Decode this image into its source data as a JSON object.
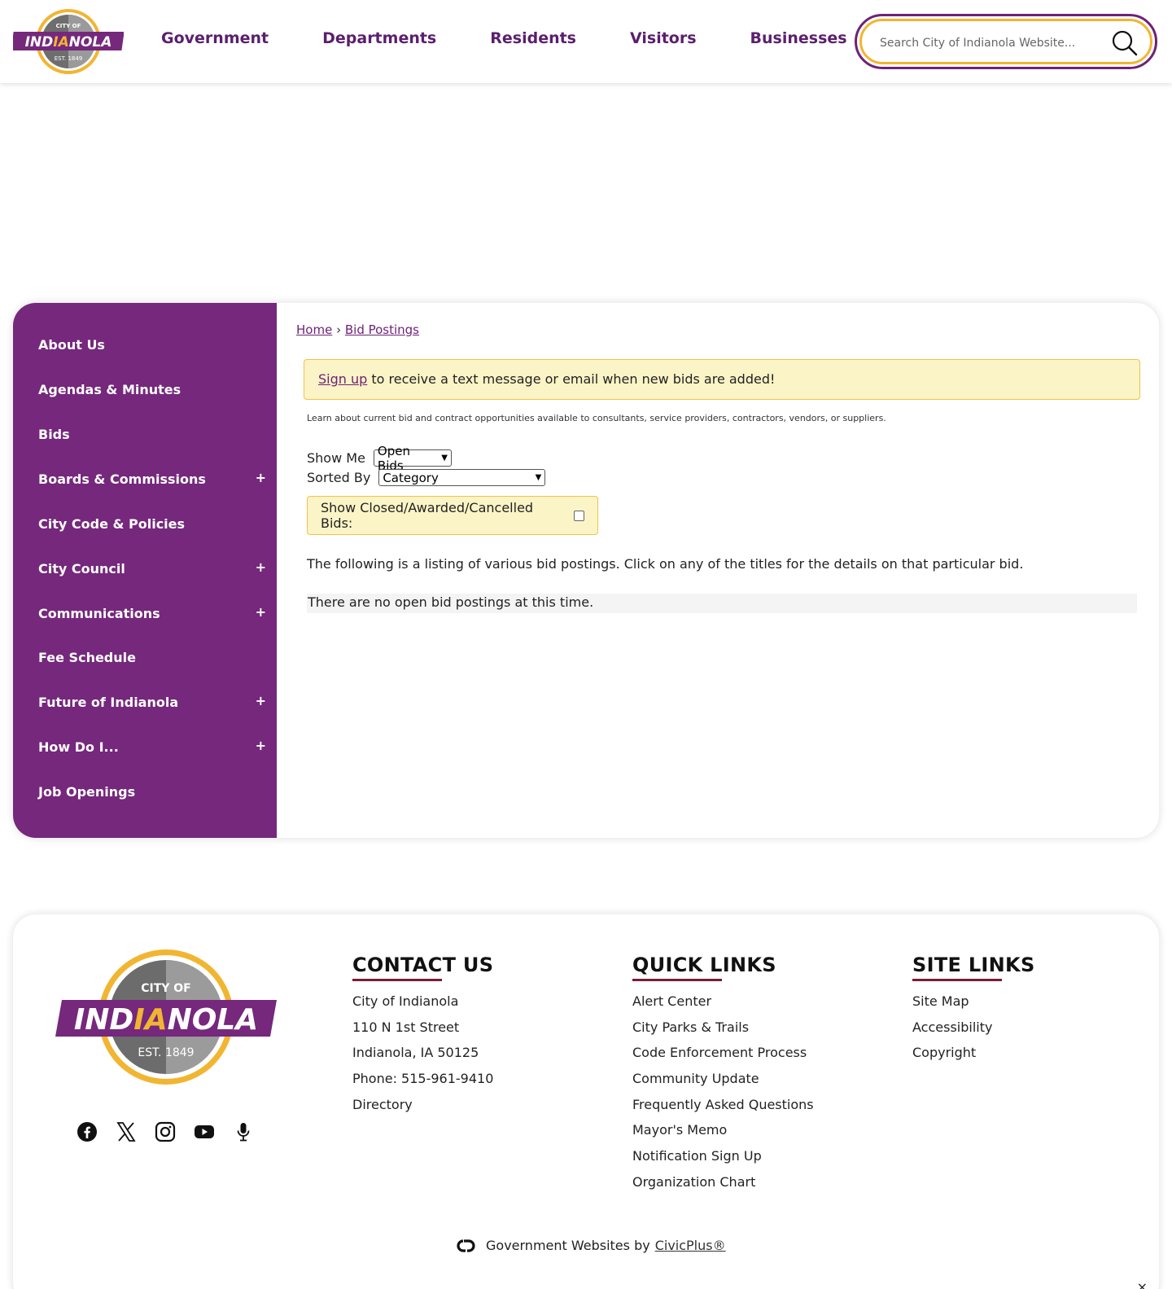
{
  "header": {
    "logo": {
      "top_text": "CITY OF",
      "name_part1": "IND",
      "name_part2": "IA",
      "name_part3": "NOLA",
      "est": "EST. 1849"
    },
    "nav": [
      "Government",
      "Departments",
      "Residents",
      "Visitors",
      "Businesses"
    ],
    "search": {
      "placeholder": "Search City of Indianola Website..."
    }
  },
  "sidebar": {
    "items": [
      {
        "label": "About Us",
        "expandable": false
      },
      {
        "label": "Agendas & Minutes",
        "expandable": false
      },
      {
        "label": "Bids",
        "expandable": false
      },
      {
        "label": "Boards & Commissions",
        "expandable": true
      },
      {
        "label": "City Code & Policies",
        "expandable": false
      },
      {
        "label": "City Council",
        "expandable": true
      },
      {
        "label": "Communications",
        "expandable": true
      },
      {
        "label": "Fee Schedule",
        "expandable": false
      },
      {
        "label": "Future of Indianola",
        "expandable": true
      },
      {
        "label": "How Do I...",
        "expandable": true
      },
      {
        "label": "Job Openings",
        "expandable": false
      }
    ],
    "plus_symbol": "+"
  },
  "content": {
    "breadcrumb": {
      "home": "Home",
      "separator": "›",
      "current": "Bid Postings"
    },
    "signup": {
      "link": "Sign up",
      "text": " to receive a text message or email when new bids are added!"
    },
    "learn_text": "Learn about current bid and contract opportunities available to consultants, service providers, contractors, vendors, or suppliers.",
    "show_me": {
      "label": "Show Me",
      "selected": "Open Bids"
    },
    "sorted_by": {
      "label": "Sorted By",
      "selected": "Category"
    },
    "closed_label": "Show Closed/Awarded/Cancelled Bids:",
    "closed_checked": false,
    "listing_text": "The following is a listing of various bid postings. Click on any of the titles for the details on that particular bid.",
    "no_bids": "There are no open bid postings at this time."
  },
  "footer": {
    "social_icons": [
      "facebook-icon",
      "x-twitter-icon",
      "instagram-icon",
      "youtube-icon",
      "microphone-icon"
    ],
    "contact": {
      "heading": "CONTACT US",
      "lines": [
        "City of Indianola",
        "110 N 1st Street",
        "Indianola, IA 50125",
        "Phone: 515-961-9410"
      ],
      "directory_link": "Directory"
    },
    "quick_links": {
      "heading": "QUICK LINKS",
      "links": [
        "Alert Center",
        "City Parks & Trails",
        "Code Enforcement Process",
        "Community Update",
        "Frequently Asked Questions",
        "Mayor's Memo",
        "Notification Sign Up",
        "Organization Chart"
      ]
    },
    "site_links": {
      "heading": "SITE LINKS",
      "links": [
        "Site Map",
        "Accessibility",
        "Copyright"
      ]
    },
    "credit": {
      "text": "Government Websites by",
      "link": "CivicPlus®"
    },
    "close_symbol": "×"
  },
  "colors": {
    "brand_purple": "#75287c",
    "nav_purple": "#5b1f6e",
    "gold": "#f2b531",
    "highlight_bg": "#fbf4c6",
    "heading_underline": "#7a1d36"
  }
}
